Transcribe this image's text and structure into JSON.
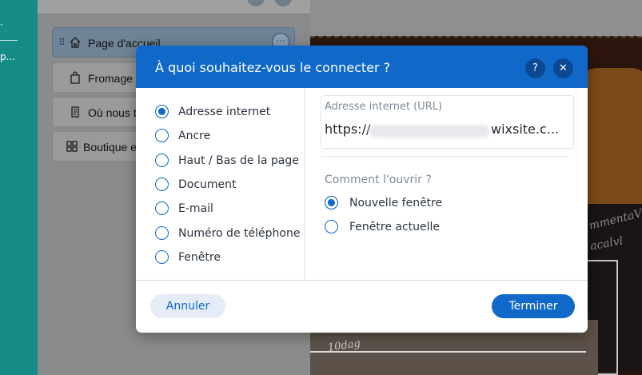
{
  "sidebar_rail": {
    "menu_fragment_1": "·",
    "menu_fragment_2": "p..."
  },
  "pages_panel": {
    "items": [
      {
        "label": "Page d'accueil",
        "icon": "home-icon",
        "active": true
      },
      {
        "label": "Fromage",
        "icon": "shopping-bag-icon",
        "active": false
      },
      {
        "label": "Où nous t",
        "icon": "document-icon",
        "active": false
      },
      {
        "label": "Boutique e",
        "icon": "grid-icon",
        "active": false
      }
    ],
    "more_label": "···"
  },
  "preview": {
    "chalk_text_1": "mmentaV",
    "chalk_text_2": "acalvl",
    "sign_small": "10dag"
  },
  "modal": {
    "title": "À quoi souhaitez-vous le connecter ?",
    "help_label": "?",
    "close_label": "✕",
    "link_types": [
      {
        "label": "Adresse internet",
        "selected": true
      },
      {
        "label": "Ancre",
        "selected": false
      },
      {
        "label": "Haut / Bas de la page",
        "selected": false
      },
      {
        "label": "Document",
        "selected": false
      },
      {
        "label": "E-mail",
        "selected": false
      },
      {
        "label": "Numéro de téléphone",
        "selected": false
      },
      {
        "label": "Fenêtre",
        "selected": false
      }
    ],
    "url_field": {
      "label": "Adresse internet (URL)",
      "value_start": "https://",
      "value_end": "wixsite.c..."
    },
    "open_label": "Comment l'ouvrir ?",
    "open_options": [
      {
        "label": "Nouvelle fenêtre",
        "selected": true
      },
      {
        "label": "Fenêtre actuelle",
        "selected": false
      }
    ],
    "cancel_label": "Annuler",
    "done_label": "Terminer"
  },
  "colors": {
    "accent": "#1068c8",
    "rail": "#168c87",
    "header": "#1068c8"
  }
}
